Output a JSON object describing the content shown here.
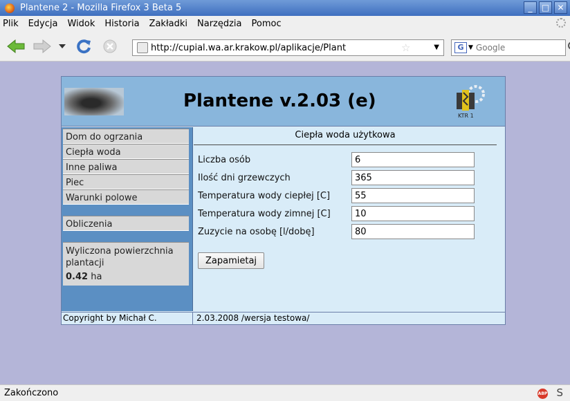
{
  "window": {
    "title": "Plantene 2 - Mozilla Firefox 3 Beta 5",
    "controls": [
      "_",
      "□",
      "✕"
    ]
  },
  "menubar": {
    "items": [
      "Plik",
      "Edycja",
      "Widok",
      "Historia",
      "Zakładki",
      "Narzędzia",
      "Pomoc"
    ]
  },
  "toolbar": {
    "url": "http://cupial.wa.ar.krakow.pl/aplikacje/Plant",
    "search_placeholder": "Google",
    "icons": [
      "back-arrow-icon",
      "forward-arrow-icon",
      "history-dropdown-icon",
      "reload-icon",
      "stop-icon",
      "site-icon",
      "star-icon",
      "google-icon",
      "magnifier-icon"
    ]
  },
  "app": {
    "title": "Plantene v.2.03 (e)",
    "logo_right_text": "KTR 1",
    "nav": {
      "group1": [
        "Dom do ogrzania",
        "Ciepła woda",
        "Inne paliwa",
        "Piec",
        "Warunki polowe"
      ],
      "group2": [
        "Obliczenia"
      ]
    },
    "area": {
      "label": "Wyliczona powierzchnia plantacji",
      "value": "0.42",
      "unit": "ha"
    },
    "section_title": "Ciepła woda użytkowa",
    "form": [
      {
        "label": "Liczba osób",
        "value": "6"
      },
      {
        "label": "Ilość dni grzewczych",
        "value": "365"
      },
      {
        "label": "Temperatura wody ciepłej [C]",
        "value": "55"
      },
      {
        "label": "Temperatura wody zimnej [C]",
        "value": "10"
      },
      {
        "label": "Zuzycie na osobę [l/dobę]",
        "value": "80"
      }
    ],
    "save_button": "Zapamietaj",
    "footer": {
      "copyright": "Copyright by Michał C.",
      "version": "2.03.2008 /wersja testowa/"
    }
  },
  "statusbar": {
    "status": "Zakończono",
    "abp_label": "ABP",
    "s_label": "S"
  },
  "colors": {
    "page_bg": "#b4b5d8",
    "header_bg": "#89b6dc",
    "sidebar_bg": "#5b8fc3",
    "panel_bg": "#d9ecf8",
    "titlebar": "#4a7ac8"
  }
}
